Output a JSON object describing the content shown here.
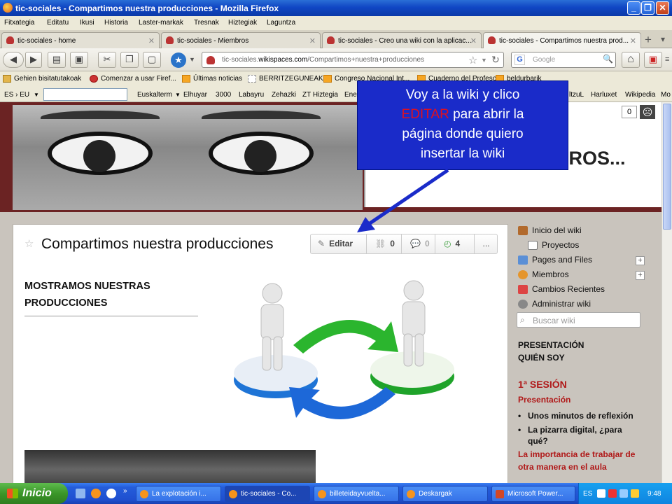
{
  "window": {
    "title": "tic-sociales - Compartimos nuestra producciones - Mozilla Firefox",
    "minimize": "_",
    "maximize": "❐",
    "close": "✕"
  },
  "menu": [
    "Fitxategia",
    "Editatu",
    "Ikusi",
    "Historia",
    "Laster-markak",
    "Tresnak",
    "Hiztegiak",
    "Laguntza"
  ],
  "tabs": [
    {
      "label": "tic-sociales - home",
      "close": "✕"
    },
    {
      "label": "tic-sociales - Miembros",
      "close": "✕"
    },
    {
      "label": "tic-sociales - Creo una wiki con la aplicac...",
      "close": "✕"
    },
    {
      "label": "tic-sociales - Compartimos nuestra prod...",
      "close": "✕"
    }
  ],
  "new_tab": "+",
  "tab_list": "▾",
  "nav": {
    "back": "◀",
    "forward": "▶",
    "url_domain_pre": "tic-sociales.",
    "url_domain": "wikispaces.com",
    "url_path": "/Compartimos+nuestra+producciones",
    "search_placeholder": "Google",
    "star": "☆",
    "reload": "↻",
    "search_engine": "G",
    "search_icon": "🔍",
    "home": "⌂",
    "addon": "▣",
    "menu": "≡"
  },
  "bookmarks": [
    "Gehien bisitatutakoak",
    "Comenzar a usar Firef...",
    "Últimas noticias",
    "BERRITZEGUNEAK",
    "Congreso Nacional Int...",
    "Cuaderno del Profesor",
    "beldurbarik"
  ],
  "lang_toolbar": {
    "lang": "ES › EU",
    "items": [
      "Euskalterm",
      "Elhuyar",
      "3000",
      "Labayru",
      "Zehazki",
      "ZT Hiztegia",
      "Ene"
    ],
    "items_right": [
      "ltzuL",
      "Harluxet",
      "Wikipedia",
      "Mo"
    ]
  },
  "banner": {
    "title": "...ROS...",
    "counter": "0",
    "smiley": "☹"
  },
  "page": {
    "title": "Compartimos nuestra producciones",
    "star": "☆",
    "actions": {
      "edit": "Editar",
      "links": "0",
      "comments": "0",
      "history": "4",
      "more": "..."
    },
    "heading_line1": "MOSTRAMOS NUESTRAS",
    "heading_line2": "PRODUCCIONES"
  },
  "sidebar": {
    "items": [
      {
        "label": "Inicio del wiki"
      },
      {
        "label": "Proyectos"
      },
      {
        "label": "Pages and Files"
      },
      {
        "label": "Miembros"
      },
      {
        "label": "Cambios Recientes"
      },
      {
        "label": "Administrar wiki"
      }
    ],
    "plus": "+",
    "search_placeholder": "Buscar wiki",
    "section1_line1": "PRESENTACIÓN",
    "section1_line2": "QUIÉN SOY",
    "session": "1ª SESIÓN",
    "presentation": "Presentación",
    "bullets": [
      "Unos minutos de reflexión",
      "La pizarra digital, ¿para qué?"
    ],
    "link_line1": "La importancia de trabajar de",
    "link_line2": "otra manera en el aula"
  },
  "callout": {
    "line1": "Voy a la wiki y clico",
    "highlight": "EDITAR",
    "line2_rest": " para abrir la",
    "line3": "página donde quiero",
    "line4": "insertar la wiki"
  },
  "taskbar": {
    "start": "Inicio",
    "tasks": [
      "La explotación i...",
      "tic-sociales - Co...",
      "billeteidayvuelta...",
      "Deskargak",
      "Microsoft Power..."
    ],
    "lang": "ES",
    "time": "9:48"
  },
  "colors": {
    "callout_bg": "#1a2bc9",
    "callout_highlight": "#e0101e",
    "title_bar": "#1046c4",
    "arrow": "#1a2bc9"
  }
}
